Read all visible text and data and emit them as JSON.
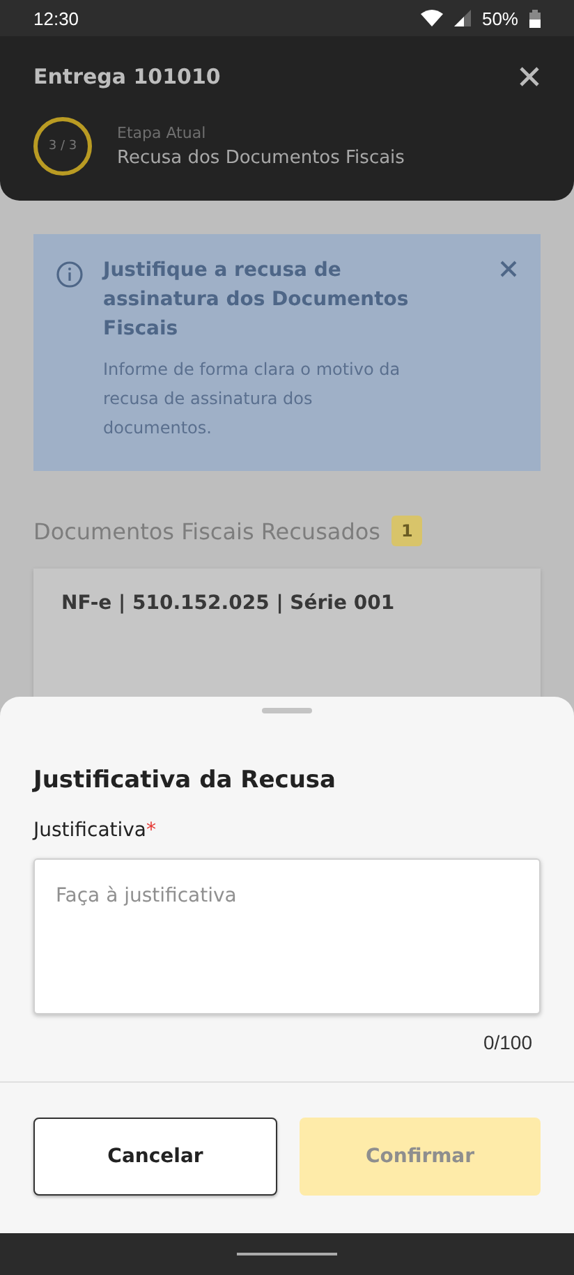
{
  "status_bar": {
    "time": "12:30",
    "battery": "50%"
  },
  "header": {
    "title": "Entrega 101010",
    "step": {
      "counter": "3 / 3",
      "label": "Etapa Atual",
      "name": "Recusa dos Documentos Fiscais"
    }
  },
  "info_banner": {
    "title": "Justifique a recusa de assinatura dos Documentos Fiscais",
    "message": "Informe de forma clara o motivo da recusa de assinatura dos documentos."
  },
  "section": {
    "title": "Documentos Fiscais Recusados",
    "count": "1"
  },
  "document_card": {
    "title": "NF-e | 510.152.025 | Série 001"
  },
  "sheet": {
    "title": "Justificativa da Recusa",
    "field": {
      "label": "Justificativa",
      "required_mark": "*",
      "placeholder": "Faça à justificativa",
      "counter": "0/100"
    },
    "buttons": [
      {
        "label": "Cancelar",
        "kind": "secondary",
        "disabled": false
      },
      {
        "label": "Confirmar",
        "kind": "primary",
        "disabled": true
      }
    ]
  }
}
